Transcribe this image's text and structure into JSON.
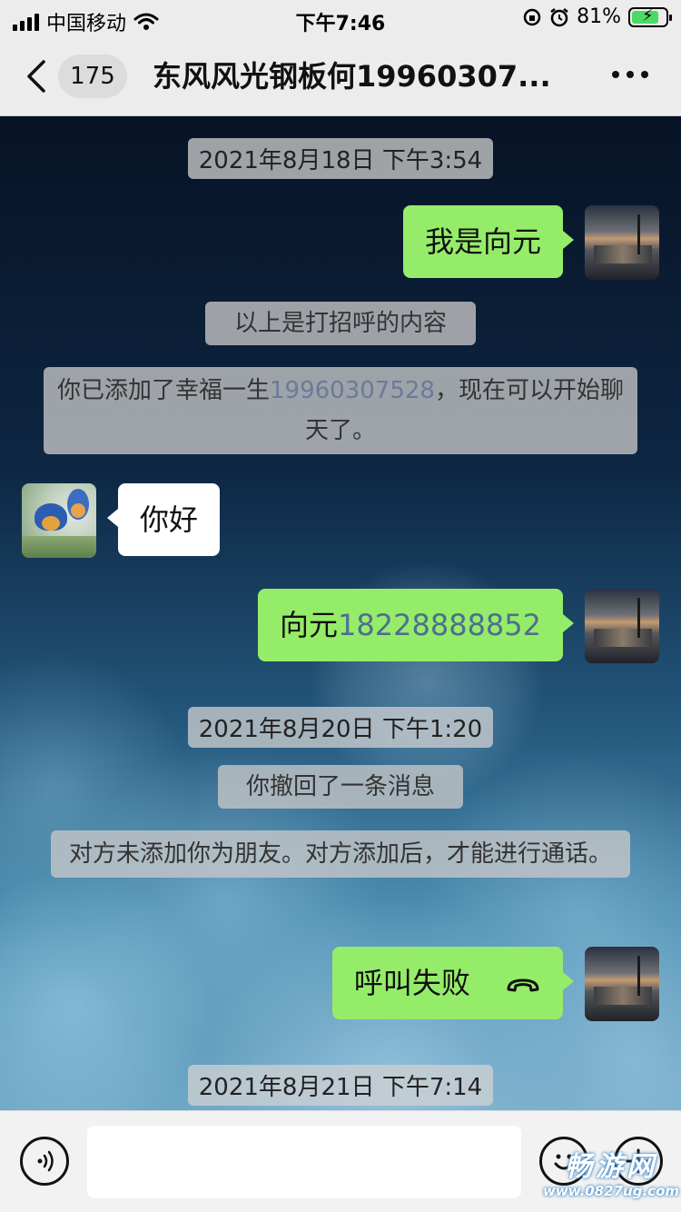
{
  "status_bar": {
    "carrier": "中国移动",
    "time": "下午7:46",
    "battery_percent": "81%",
    "battery_level": 0.81
  },
  "nav": {
    "back_count": "175",
    "title": "东风风光钢板何19960307..."
  },
  "chat": {
    "timestamp1": "2021年8月18日 下午3:54",
    "msg1": "我是向元",
    "sys1": "以上是打招呼的内容",
    "sys2_prefix": "你已添加了幸福一生",
    "sys2_number": "19960307528",
    "sys2_suffix": "，现在可以开始聊天了。",
    "msg2": "你好",
    "msg3_prefix": "向元",
    "msg3_number": "18228888852",
    "timestamp2": "2021年8月20日 下午1:20",
    "sys3": "你撤回了一条消息",
    "sys4": "对方未添加你为朋友。对方添加后，才能进行通话。",
    "msg4": "呼叫失败",
    "timestamp3": "2021年8月21日 下午7:14"
  },
  "input_bar": {
    "placeholder": ""
  },
  "watermark": {
    "line1": "畅游网",
    "line2": "www.0827ug.com"
  },
  "colors": {
    "outgoing_bubble": "#95ec69",
    "incoming_bubble": "#ffffff",
    "link_number": "#4e6f8e"
  }
}
